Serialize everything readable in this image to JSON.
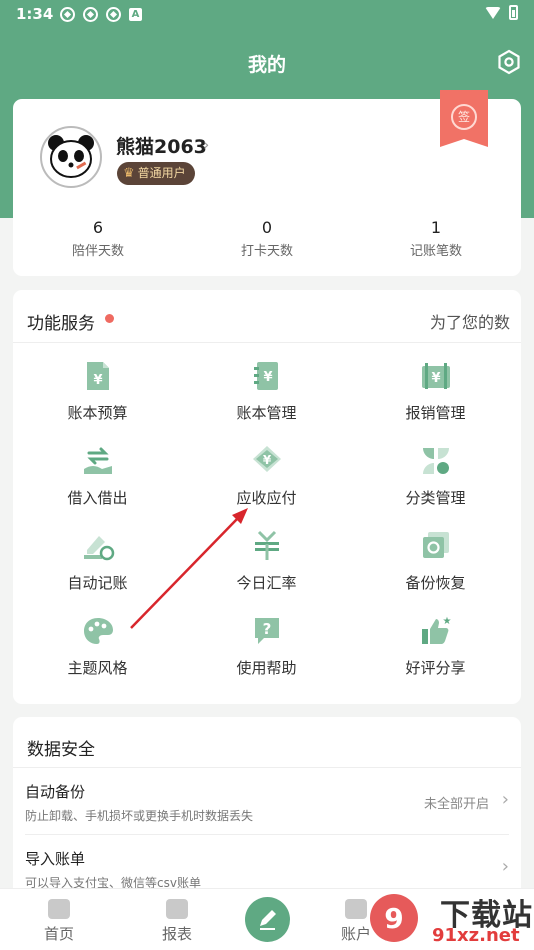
{
  "status_bar": {
    "time": "1:34",
    "notification_icons": [
      "app-icon",
      "app-icon",
      "app-icon"
    ],
    "a_icon": "A"
  },
  "header": {
    "title": "我的"
  },
  "profile": {
    "username": "熊猫2063",
    "chevron": "›",
    "badge": "普通用户",
    "sign_label": "签",
    "stats": [
      {
        "value": "6",
        "label": "陪伴天数"
      },
      {
        "value": "0",
        "label": "打卡天数"
      },
      {
        "value": "1",
        "label": "记账笔数"
      }
    ]
  },
  "services": {
    "title": "功能服务",
    "hint": "为了您的数",
    "items": [
      {
        "label": "账本预算",
        "icon": "budget-icon"
      },
      {
        "label": "账本管理",
        "icon": "ledger-icon"
      },
      {
        "label": "报销管理",
        "icon": "reimburse-icon"
      },
      {
        "label": "借入借出",
        "icon": "lend-borrow-icon"
      },
      {
        "label": "应收应付",
        "icon": "receivable-icon"
      },
      {
        "label": "分类管理",
        "icon": "category-icon"
      },
      {
        "label": "自动记账",
        "icon": "auto-record-icon"
      },
      {
        "label": "今日汇率",
        "icon": "exchange-rate-icon"
      },
      {
        "label": "备份恢复",
        "icon": "backup-icon"
      },
      {
        "label": "主题风格",
        "icon": "palette-icon"
      },
      {
        "label": "使用帮助",
        "icon": "help-icon"
      },
      {
        "label": "好评分享",
        "icon": "thumbs-up-icon"
      }
    ]
  },
  "security": {
    "title": "数据安全",
    "rows": [
      {
        "title": "自动备份",
        "subtitle": "防止卸载、手机损坏或更换手机时数据丢失",
        "status": "未全部开启"
      },
      {
        "title": "导入账单",
        "subtitle": "可以导入支付宝、微信等csv账单",
        "status": ""
      }
    ]
  },
  "bottom_nav": [
    {
      "label": "首页"
    },
    {
      "label": "报表"
    },
    {
      "label": "账户"
    }
  ],
  "watermark": {
    "text": "下载站",
    "sub": "91xz.net"
  },
  "colors": {
    "accent": "#5fa983",
    "icon_green": "#8fc3a6",
    "ribbon": "#f17266",
    "arrow": "#d8262c"
  }
}
